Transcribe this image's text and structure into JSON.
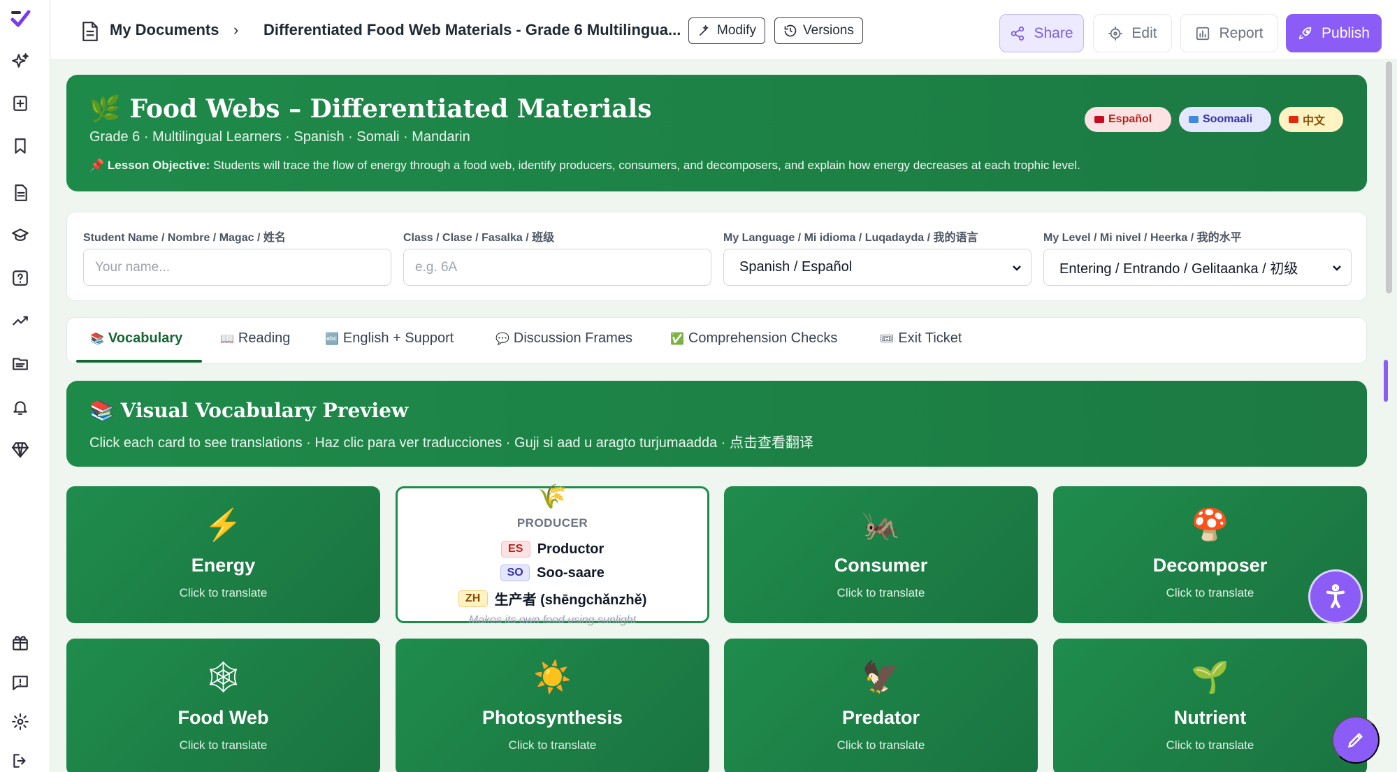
{
  "breadcrumb": {
    "root": "My Documents",
    "separator": "›",
    "current": "Differentiated Food Web Materials - Grade 6 Multilingua..."
  },
  "toolbar": {
    "modify_label": "Modify",
    "versions_label": "Versions"
  },
  "actions": {
    "share": "Share",
    "edit": "Edit",
    "report": "Report",
    "publish": "Publish"
  },
  "hero": {
    "icon": "🌿",
    "title": "Food Webs – Differentiated Materials",
    "subtitle": "Grade 6 · Multilingual Learners · Spanish · Somali · Mandarin",
    "objective_icon": "📌",
    "objective_label": "Lesson Objective:",
    "objective_text": " Students will trace the flow of energy through a food web, identify producers, consumers, and decomposers, and explain how energy decreases at each trophic level.",
    "languages": [
      {
        "label": "Español",
        "flag_color": "#c60b1e"
      },
      {
        "label": "Soomaali",
        "flag_color": "#4189dd"
      },
      {
        "label": "中文",
        "flag_color": "#de2910"
      }
    ]
  },
  "form": {
    "name_label": "Student Name / Nombre / Magac / 姓名",
    "name_placeholder": "Your name...",
    "class_label": "Class / Clase / Fasalka / 班级",
    "class_placeholder": "e.g. 6A",
    "language_label": "My Language / Mi idioma / Luqadayda / 我的语言",
    "language_value": "Spanish / Español",
    "level_label": "My Level / Mi nivel / Heerka / 我的水平",
    "level_value": "Entering / Entrando / Gelitaanka / 初级"
  },
  "tabs": [
    {
      "icon": "📚",
      "label": "Vocabulary",
      "active": true
    },
    {
      "icon": "📖",
      "label": "Reading",
      "active": false
    },
    {
      "icon": "🔤",
      "label": "English + Support",
      "active": false
    },
    {
      "icon": "💬",
      "label": "Discussion Frames",
      "active": false
    },
    {
      "icon": "✅",
      "label": "Comprehension Checks",
      "active": false
    },
    {
      "icon": "🎟",
      "label": "Exit Ticket",
      "active": false
    }
  ],
  "vocab_banner": {
    "icon": "📚",
    "title": "Visual Vocabulary Preview",
    "subtitle": "Click each card to see translations · Haz clic para ver traducciones · Guji si aad u aragto turjumaadda · 点击查看翻译"
  },
  "vocab_cards": [
    {
      "icon": "⚡",
      "term": "Energy",
      "hint": "Click to translate"
    },
    {
      "icon": "🌾",
      "term": "PRODUCER",
      "flipped": true,
      "translations": [
        {
          "code": "ES",
          "text": "Productor"
        },
        {
          "code": "SO",
          "text": "Soo-saare"
        },
        {
          "code": "ZH",
          "text": "生产者 (shēngchǎnzhě)"
        }
      ],
      "definition": "Makes its own food using sunlight"
    },
    {
      "icon": "🦗",
      "term": "Consumer",
      "hint": "Click to translate"
    },
    {
      "icon": "🍄",
      "term": "Decomposer",
      "hint": "Click to translate"
    },
    {
      "icon": "🕸",
      "term": "Food Web",
      "hint": "Click to translate"
    },
    {
      "icon": "☀️",
      "term": "Photosynthesis",
      "hint": "Click to translate"
    },
    {
      "icon": "🦅",
      "term": "Predator",
      "hint": "Click to translate"
    },
    {
      "icon": "🌱",
      "term": "Nutrient",
      "hint": "Click to translate"
    }
  ],
  "colors": {
    "primary_green": "#1e8a4a",
    "accent_purple": "#8b5cf6"
  }
}
